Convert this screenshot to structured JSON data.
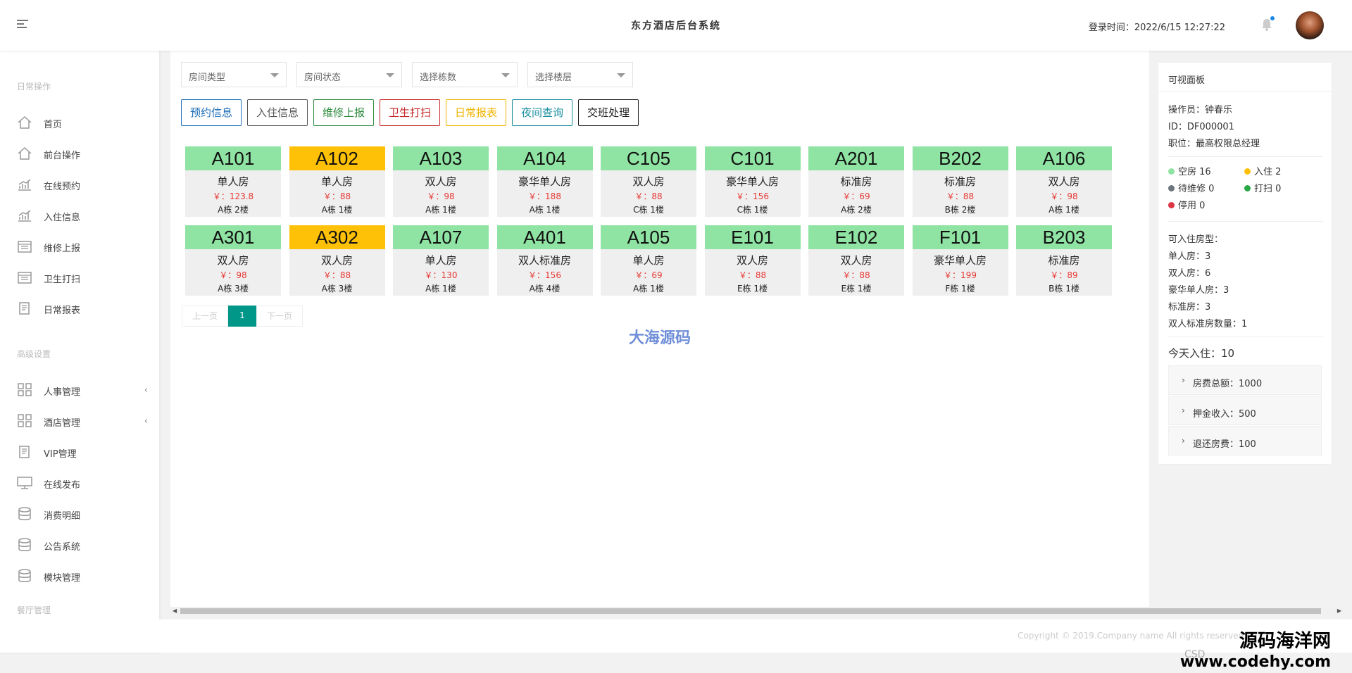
{
  "header": {
    "title": "东方酒店后台系统",
    "login_time": "登录时间：2022/6/15 12:27:22"
  },
  "sidebar": {
    "sections": [
      "日常操作",
      "高级设置",
      "餐厅管理"
    ],
    "items": [
      {
        "label": "首页",
        "icon": "home-icon"
      },
      {
        "label": "前台操作",
        "icon": "home-icon"
      },
      {
        "label": "在线预约",
        "icon": "bar-chart-icon"
      },
      {
        "label": "入住信息",
        "icon": "bar-chart-icon"
      },
      {
        "label": "维修上报",
        "icon": "calendar-icon"
      },
      {
        "label": "卫生打扫",
        "icon": "calendar-icon"
      },
      {
        "label": "日常报表",
        "icon": "document-icon"
      },
      {
        "label": "人事管理",
        "icon": "grid-icon"
      },
      {
        "label": "酒店管理",
        "icon": "grid-icon"
      },
      {
        "label": "VIP管理",
        "icon": "document-icon"
      },
      {
        "label": "在线发布",
        "icon": "monitor-icon"
      },
      {
        "label": "消费明细",
        "icon": "database-icon"
      },
      {
        "label": "公告系统",
        "icon": "database-icon"
      },
      {
        "label": "模块管理",
        "icon": "database-icon"
      }
    ]
  },
  "filters": [
    {
      "placeholder": "房间类型"
    },
    {
      "placeholder": "房间状态"
    },
    {
      "placeholder": "选择栋数"
    },
    {
      "placeholder": "选择楼层"
    }
  ],
  "actions": [
    {
      "label": "预约信息",
      "color": "#1e6fb8"
    },
    {
      "label": "入住信息",
      "color": "#555555"
    },
    {
      "label": "维修上报",
      "color": "#2e8b3e"
    },
    {
      "label": "卫生打扫",
      "color": "#c62828"
    },
    {
      "label": "日常报表",
      "color": "#f0b400"
    },
    {
      "label": "夜间查询",
      "color": "#1b8fa0"
    },
    {
      "label": "交班处理",
      "color": "#222222"
    }
  ],
  "status_colors": {
    "vacant": "#8fe3a3",
    "occupied": "#ffc107",
    "maintenance": "#6c757d",
    "cleaning": "#28a745",
    "disabled": "#dc3545"
  },
  "rooms": [
    {
      "code": "A101",
      "type": "单人房",
      "price": "￥：123.8",
      "loc": "A栋 2楼",
      "status": "vacant"
    },
    {
      "code": "A102",
      "type": "单人房",
      "price": "￥：88",
      "loc": "A栋 1楼",
      "status": "occupied"
    },
    {
      "code": "A103",
      "type": "双人房",
      "price": "￥：98",
      "loc": "A栋 1楼",
      "status": "vacant"
    },
    {
      "code": "A104",
      "type": "豪华单人房",
      "price": "￥：188",
      "loc": "A栋 1楼",
      "status": "vacant"
    },
    {
      "code": "C105",
      "type": "双人房",
      "price": "￥：88",
      "loc": "C栋 1楼",
      "status": "vacant"
    },
    {
      "code": "C101",
      "type": "豪华单人房",
      "price": "￥：156",
      "loc": "C栋 1楼",
      "status": "vacant"
    },
    {
      "code": "A201",
      "type": "标准房",
      "price": "￥：69",
      "loc": "A栋 2楼",
      "status": "vacant"
    },
    {
      "code": "B202",
      "type": "标准房",
      "price": "￥：88",
      "loc": "B栋 2楼",
      "status": "vacant"
    },
    {
      "code": "A106",
      "type": "双人房",
      "price": "￥：98",
      "loc": "A栋 1楼",
      "status": "vacant"
    },
    {
      "code": "A301",
      "type": "双人房",
      "price": "￥：98",
      "loc": "A栋 3楼",
      "status": "vacant"
    },
    {
      "code": "A302",
      "type": "双人房",
      "price": "￥：88",
      "loc": "A栋 3楼",
      "status": "occupied"
    },
    {
      "code": "A107",
      "type": "单人房",
      "price": "￥：130",
      "loc": "A栋 1楼",
      "status": "vacant"
    },
    {
      "code": "A401",
      "type": "双人标准房",
      "price": "￥：156",
      "loc": "A栋 4楼",
      "status": "vacant"
    },
    {
      "code": "A105",
      "type": "单人房",
      "price": "￥：69",
      "loc": "A栋 1楼",
      "status": "vacant"
    },
    {
      "code": "E101",
      "type": "双人房",
      "price": "￥：88",
      "loc": "E栋 1楼",
      "status": "vacant"
    },
    {
      "code": "E102",
      "type": "双人房",
      "price": "￥：88",
      "loc": "E栋 1楼",
      "status": "vacant"
    },
    {
      "code": "F101",
      "type": "豪华单人房",
      "price": "￥：199",
      "loc": "F栋 1楼",
      "status": "vacant"
    },
    {
      "code": "B203",
      "type": "标准房",
      "price": "￥：89",
      "loc": "B栋 1楼",
      "status": "vacant"
    }
  ],
  "pagination": {
    "prev": "上一页",
    "current": "1",
    "next": "下一页"
  },
  "watermark_center": "大海源码",
  "panel": {
    "title": "可视面板",
    "operator": "操作员：钟春乐",
    "id": "ID：DF000001",
    "position": "职位：最高权限总经理",
    "legend": [
      {
        "label": "空房 16",
        "status": "vacant"
      },
      {
        "label": "入住 2",
        "status": "occupied"
      },
      {
        "label": "待维修 0",
        "status": "maintenance"
      },
      {
        "label": "打扫 0",
        "status": "cleaning"
      },
      {
        "label": "停用 0",
        "status": "disabled"
      }
    ],
    "available_title": "可入住房型：",
    "available": [
      "单人房：3",
      "双人房：6",
      "豪华单人房：3",
      "标准房：3",
      "双人标准房数量：1"
    ],
    "today_checkin": "今天入住：10",
    "accordion": [
      "房费总额：1000",
      "押金收入：500",
      "退还房费：100"
    ]
  },
  "footer": {
    "copyright": "Copyright © 2019.Company name All rights reserved.",
    "csdn": "CSD",
    "site_name": "源码海洋网",
    "site_url": "www.codehy.com"
  }
}
